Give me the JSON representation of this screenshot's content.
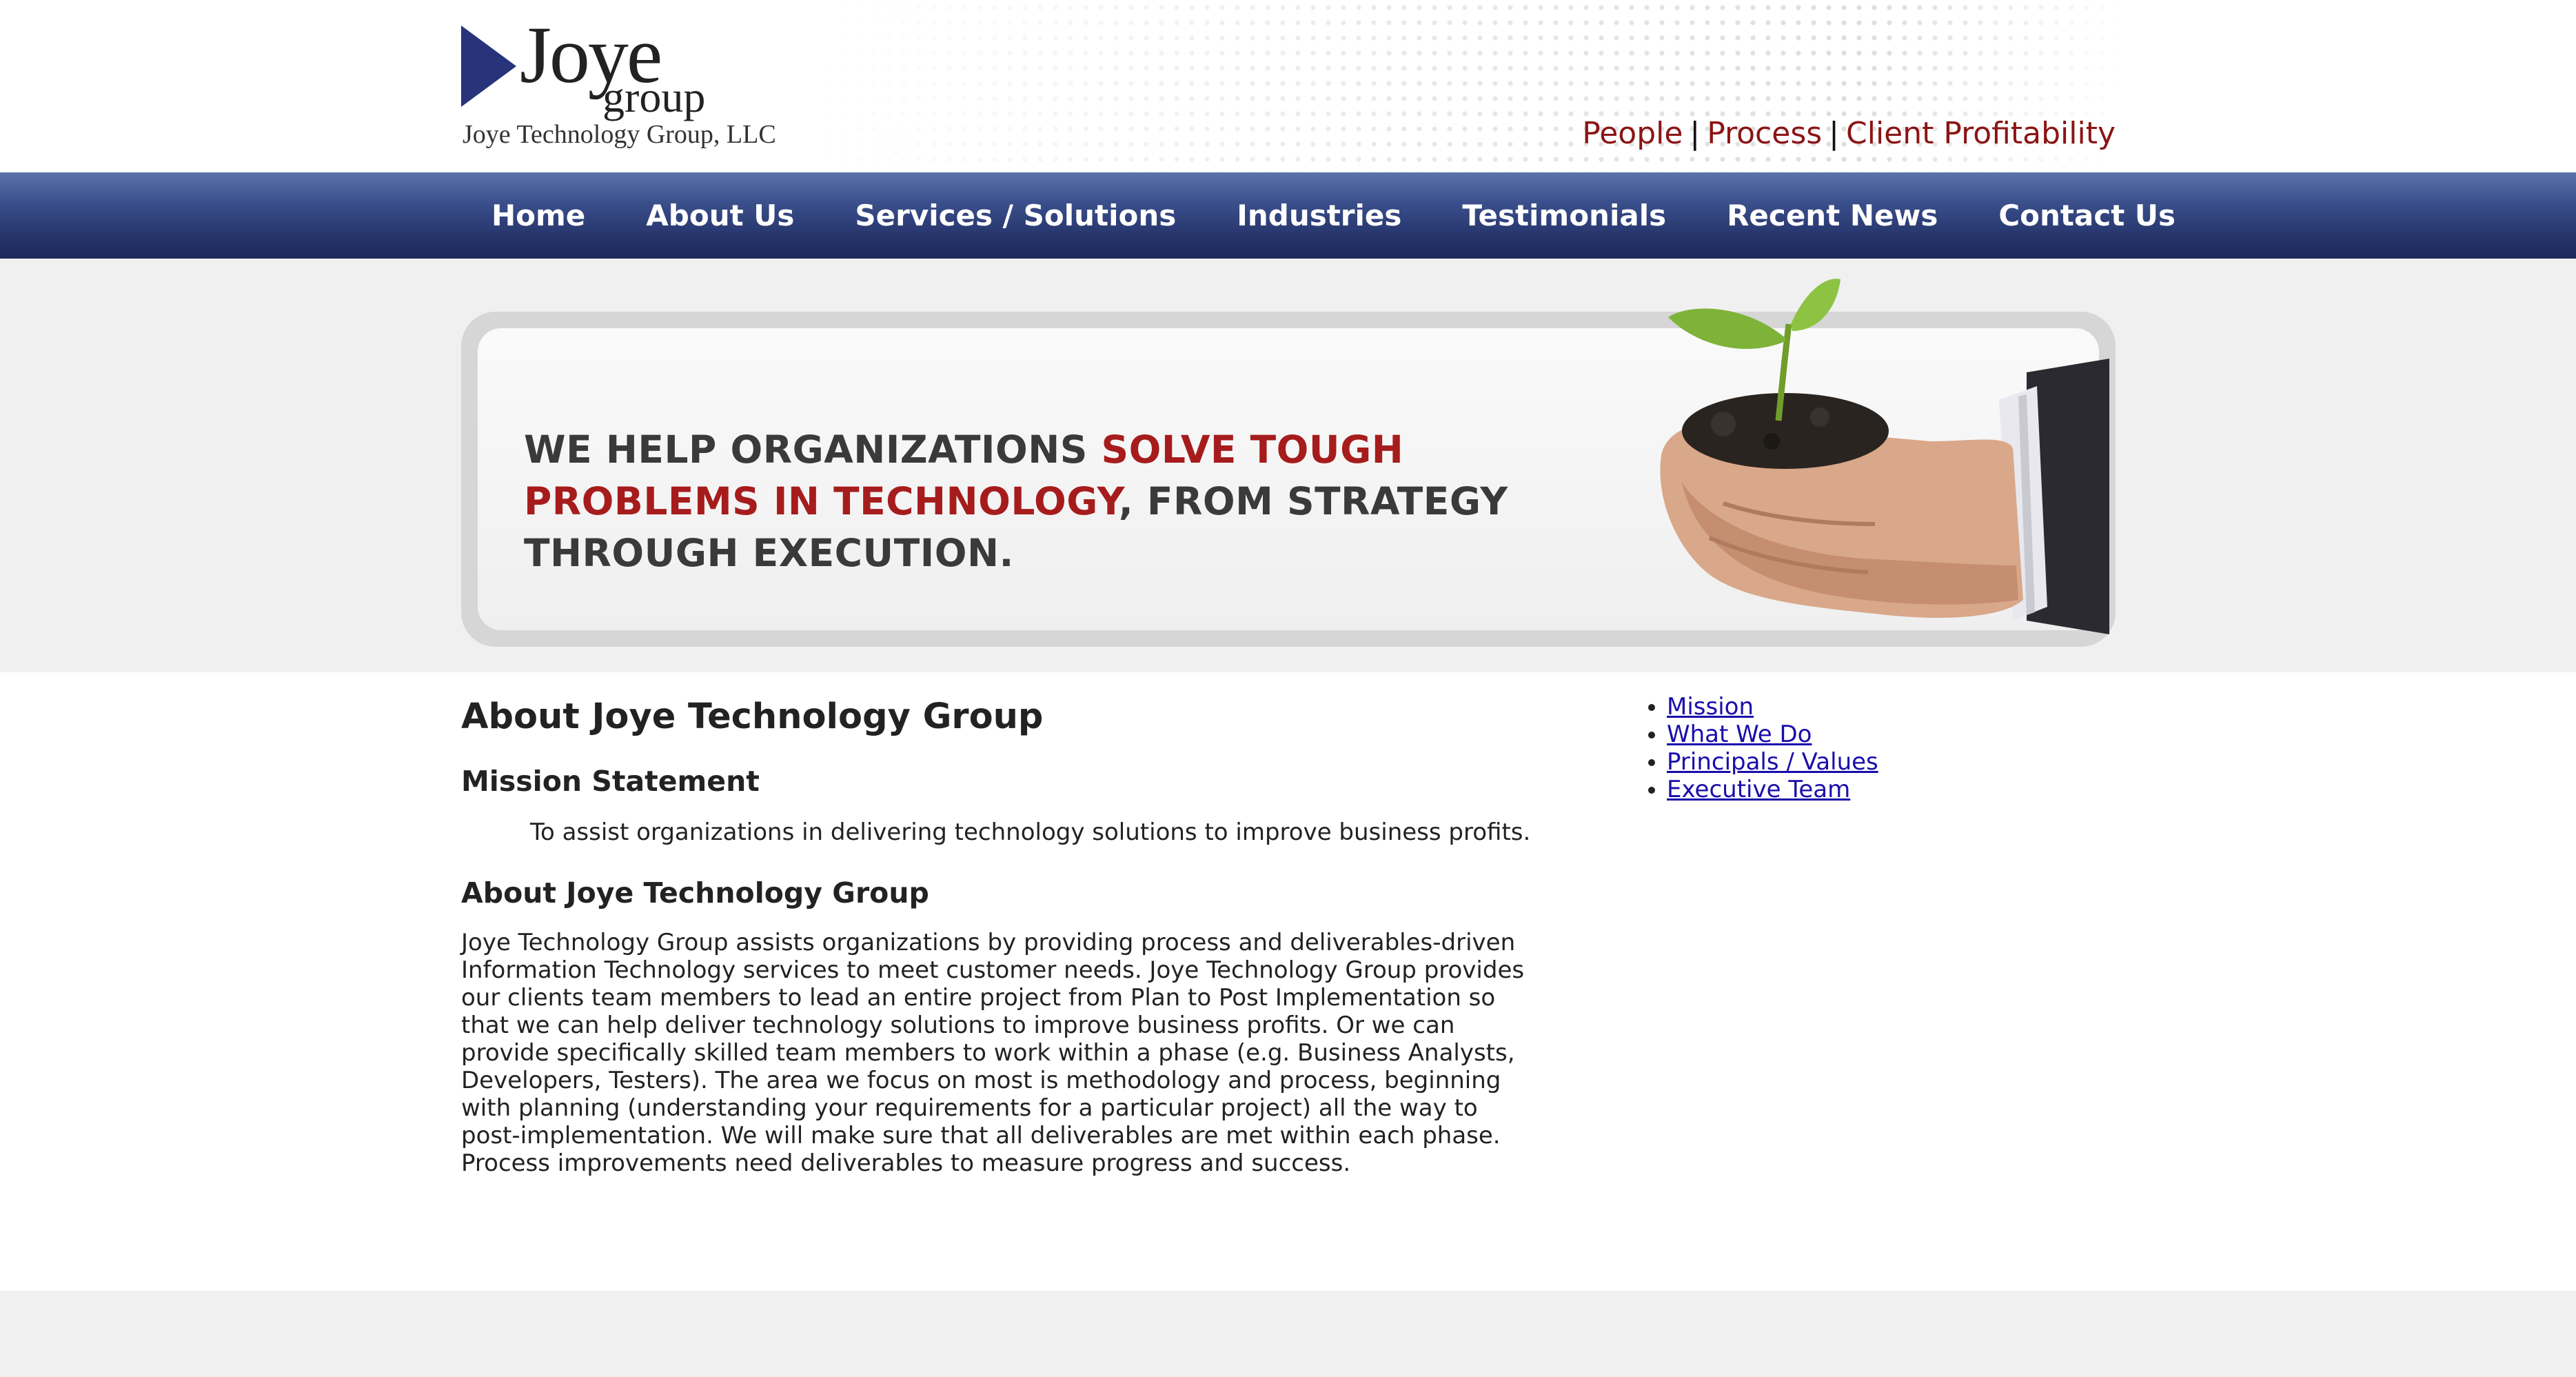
{
  "header": {
    "logo_word": "Joye",
    "logo_small": "group",
    "logo_subtitle": "Joye Technology Group, LLC",
    "tagline": [
      "People",
      "Process",
      "Client Profitability"
    ],
    "tagline_color": "#8b1414"
  },
  "nav": {
    "items": [
      {
        "label": "Home"
      },
      {
        "label": "About Us"
      },
      {
        "label": "Services / Solutions"
      },
      {
        "label": "Industries"
      },
      {
        "label": "Testimonials"
      },
      {
        "label": "Recent News"
      },
      {
        "label": "Contact Us"
      }
    ],
    "bg_color": "#2b3a75"
  },
  "banner": {
    "part1": "WE HELP ORGANIZATIONS ",
    "part2": "SOLVE TOUGH PROBLEMS IN TECHNOLOGY",
    "part3": ", FROM STRATEGY THROUGH EXECUTION.",
    "highlight_color": "#a61c1c"
  },
  "content": {
    "title": "About Joye Technology Group",
    "mission_heading": "Mission Statement",
    "mission_text": "To assist organizations in delivering technology solutions to improve business profits.",
    "about_heading": "About Joye Technology Group",
    "about_text": "Joye Technology Group assists organizations by providing process and deliverables-driven Information Technology services to meet customer needs. Joye Technology Group provides our clients team members to lead an entire project from Plan to Post Implementation so that we can help deliver technology solutions to improve business profits. Or we can provide specifically skilled team members to work within a phase (e.g. Business Analysts, Developers, Testers). The area we focus on most is methodology and process, beginning with planning (understanding your requirements for a particular project) all the way to post-implementation. We will make sure that all deliverables are met within each phase. Process improvements need deliverables to measure progress and success."
  },
  "sidebar": {
    "links": [
      {
        "label": "Mission"
      },
      {
        "label": "What We Do"
      },
      {
        "label": "Principals / Values"
      },
      {
        "label": "Executive Team"
      }
    ]
  }
}
